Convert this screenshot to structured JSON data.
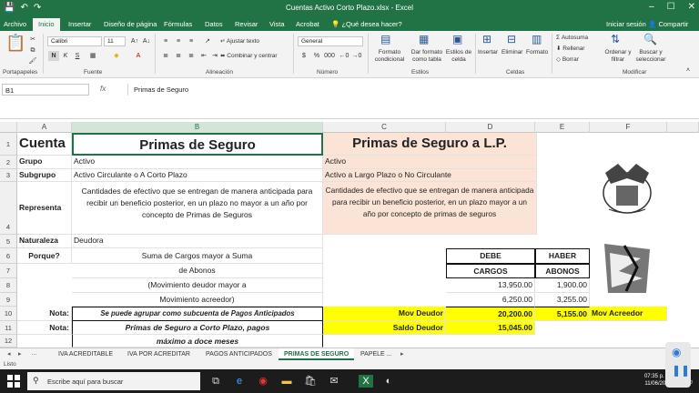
{
  "window": {
    "title": "Cuentas Activo  Corto  Plazo.xlsx - Excel"
  },
  "tabs": {
    "archivo": "Archivo",
    "inicio": "Inicio",
    "insertar": "Insertar",
    "diseno": "Diseño de página",
    "formulas": "Fórmulas",
    "datos": "Datos",
    "revisar": "Revisar",
    "vista": "Vista",
    "acrobat": "Acrobat",
    "tell": "¿Qué desea hacer?",
    "signin": "Iniciar sesión",
    "share": "Compartir"
  },
  "ribbon": {
    "font_name": "Calibri",
    "font_size": "11",
    "wrap": "Ajustar texto",
    "merge": "Combinar y centrar",
    "number_format": "General",
    "cond_format": "Formato condicional",
    "format_table": "Dar formato como tabla",
    "cell_styles": "Estilos de celda",
    "insert": "Insertar",
    "delete": "Eliminar",
    "format": "Formato",
    "autosum": "Autosuma",
    "fill": "Rellenar",
    "clear": "Borrar",
    "sort": "Ordenar y filtrar",
    "find": "Buscar y seleccionar",
    "groups": {
      "clipboard": "Portapapeles",
      "font": "Fuente",
      "alignment": "Alineación",
      "number": "Número",
      "styles": "Estilos",
      "cells": "Celdas",
      "editing": "Modificar"
    }
  },
  "formula_bar": {
    "cell": "B1",
    "fx": "fx",
    "value": "Primas de Seguro"
  },
  "columns": [
    "A",
    "B",
    "C",
    "D",
    "E",
    "F"
  ],
  "rows": [
    "1",
    "2",
    "3",
    "4",
    "5",
    "6",
    "7",
    "8",
    "9",
    "10",
    "11",
    "12"
  ],
  "cells": {
    "a1": "Cuenta",
    "b1": "Primas de Seguro",
    "c1": "Primas de Seguro a L.P.",
    "a2": "Grupo",
    "b2": "Activo",
    "c2": "Activo",
    "a3": "Subgrupo",
    "b3": "Activo Circulante o A Corto Plazo",
    "c3": "Activo a Largo Plazo o No Circulante",
    "a4": "Representa",
    "b4": "Cantidades de efectivo que se entregan de manera anticipada para recibir un beneficio posterior, en un plazo no mayor a un año por concepto de  Primas de Seguros",
    "c4": "Cantidades de efectivo que se entregan de manera anticipada para recibir un beneficio posterior, en un plazo  mayor a un año por concepto de  primas de seguros",
    "a5": "Naturaleza",
    "b5": "Deudora",
    "a6": "Porque?",
    "b6": "Suma de Cargos mayor a Suma",
    "b7": "de Abonos",
    "d6": "DEBE",
    "e6": "HABER",
    "d7": "CARGOS",
    "e7": "ABONOS",
    "b8": "(Movimiento deudor mayor a",
    "b9": "Movimiento acreedor)",
    "d8": "13,950.00",
    "e8": "1,900.00",
    "d9": "6,250.00",
    "e9": "3,255.00",
    "a10": "Nota:",
    "b10": "Se puede agrupar como subcuenta de Pagos Anticipados",
    "c10": "Mov Deudor",
    "d10": "20,200.00",
    "e10": "5,155.00",
    "f10": "Mov Acreedor",
    "a11": "Nota:",
    "b11": "Primas de Seguro a Corto Plazo, pagos",
    "b12": "máximo a doce meses",
    "c11": "Saldo Deudor",
    "d11": "15,045.00"
  },
  "sheets": [
    "IVA ACREDITABLE",
    "IVA POR ACREDITAR",
    "PAGOS ANTICIPADOS",
    "PRIMAS DE SEGURO",
    "PAPELE ..."
  ],
  "status": "Listo",
  "taskbar": {
    "search": "Escribe aquí para buscar",
    "time": "07:35 p. m.",
    "date": "11/06/2019"
  }
}
